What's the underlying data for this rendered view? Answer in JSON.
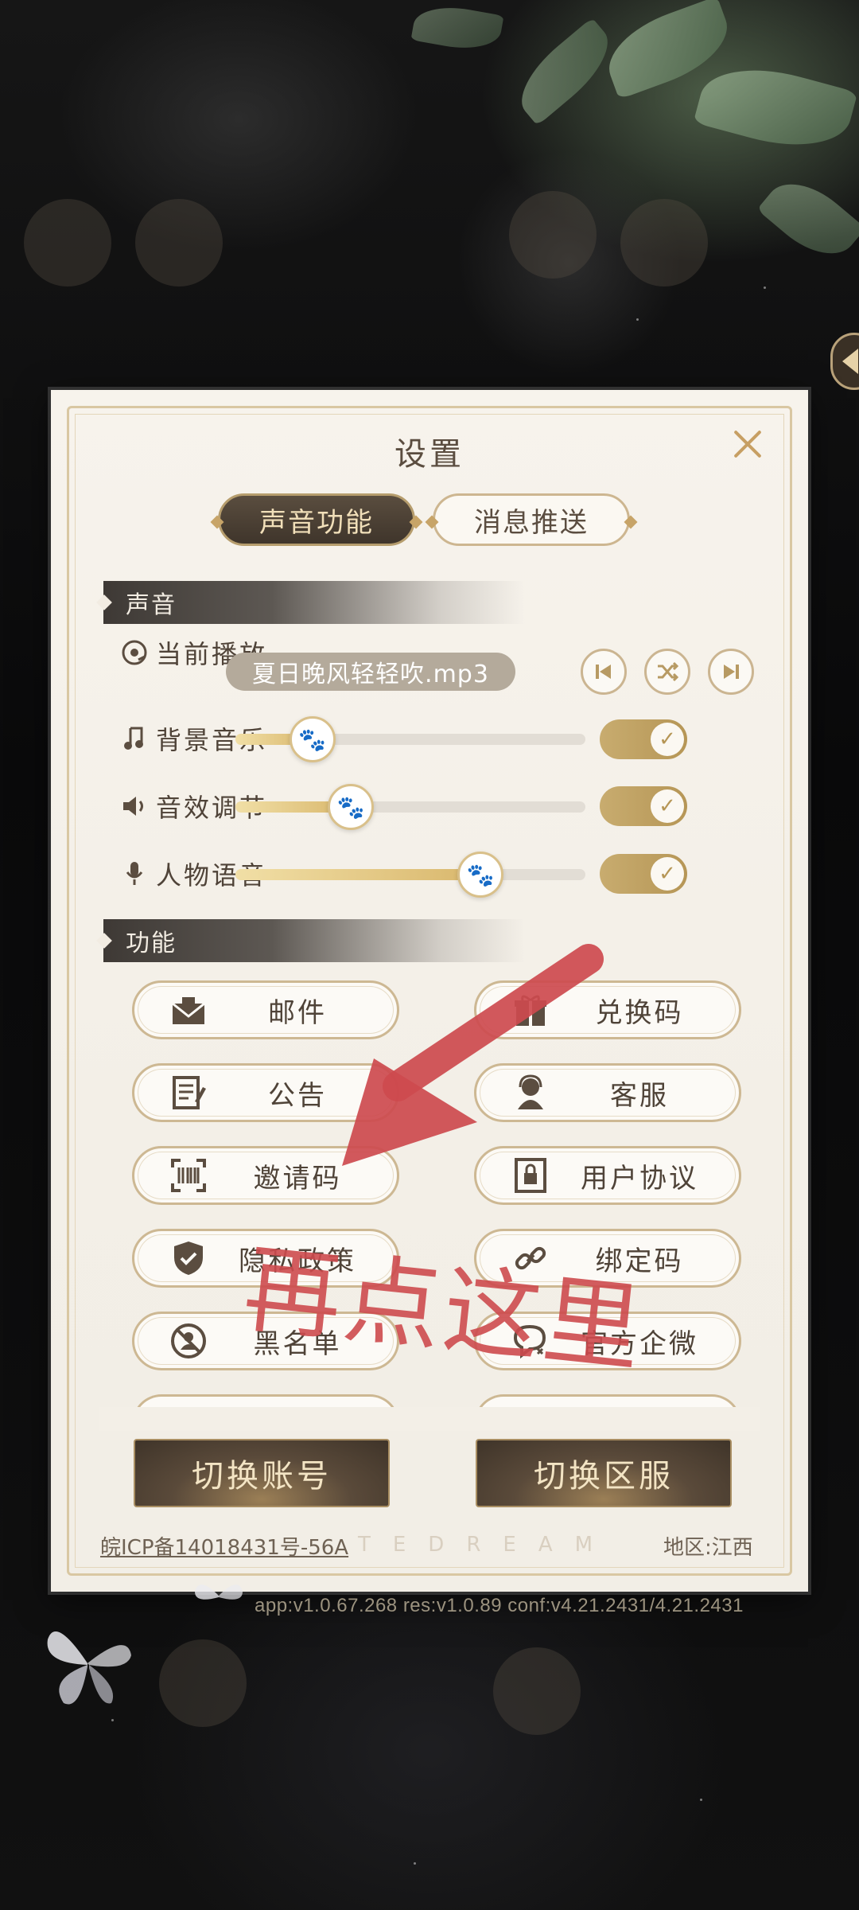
{
  "dialog": {
    "title": "设置",
    "tabs": [
      {
        "label": "声音功能",
        "active": true
      },
      {
        "label": "消息推送",
        "active": false
      }
    ]
  },
  "sound_section": {
    "header": "声音",
    "now_playing_label": "当前播放",
    "now_playing_track": "夏日晚风轻轻吹.mp3",
    "controls": [
      "previous-track",
      "shuffle",
      "next-track"
    ],
    "sliders": [
      {
        "label": "背景音乐",
        "level": 0.22,
        "enabled": true,
        "icon": "music-note-icon"
      },
      {
        "label": "音效调节",
        "level": 0.33,
        "enabled": true,
        "icon": "speaker-icon"
      },
      {
        "label": "人物语音",
        "level": 0.7,
        "enabled": true,
        "icon": "microphone-icon"
      }
    ]
  },
  "function_section": {
    "header": "功能",
    "buttons": [
      {
        "label": "邮件",
        "icon": "mail-icon"
      },
      {
        "label": "兑换码",
        "icon": "gift-icon"
      },
      {
        "label": "公告",
        "icon": "notice-icon"
      },
      {
        "label": "客服",
        "icon": "support-icon"
      },
      {
        "label": "邀请码",
        "icon": "barcode-scan-icon"
      },
      {
        "label": "用户协议",
        "icon": "lock-document-icon"
      },
      {
        "label": "隐私政策",
        "icon": "shield-check-icon"
      },
      {
        "label": "绑定码",
        "icon": "link-icon"
      },
      {
        "label": "黑名单",
        "icon": "blocked-user-icon"
      },
      {
        "label": "官方企微",
        "icon": "chat-icon"
      }
    ]
  },
  "actions": {
    "switch_account": "切换账号",
    "switch_server": "切换区服"
  },
  "footer": {
    "icp": "皖ICP备14018431号-56A",
    "watermark": "TEDREAM",
    "region": "地区:江西",
    "version": "app:v1.0.67.268 res:v1.0.89 conf:v4.21.2431/4.21.2431"
  },
  "annotation": {
    "text": "再点这里"
  },
  "colors": {
    "accent_gold": "#c7a468",
    "dark_brown": "#3f352b",
    "annotation_red": "#cd4a4e"
  }
}
